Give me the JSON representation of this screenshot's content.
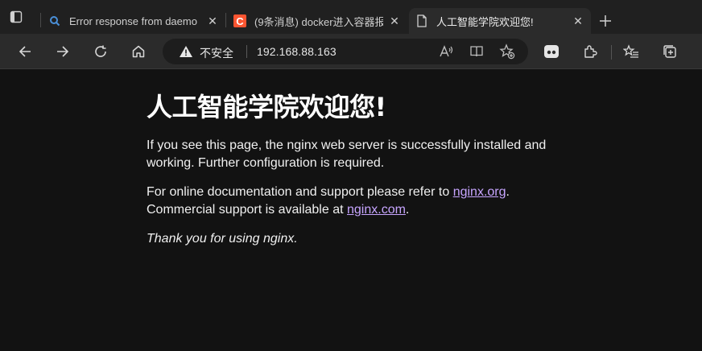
{
  "tabs": [
    {
      "title": "Error response from daemo",
      "favicon": "search-icon",
      "close": "✕"
    },
    {
      "title": "(9条消息) docker进入容器报",
      "favicon": "csdn-c-icon",
      "favicon_letter": "C",
      "close": "✕"
    },
    {
      "title": "人工智能学院欢迎您!",
      "favicon": "document-icon",
      "close": "✕",
      "active": true
    }
  ],
  "toolbar": {
    "security_label": "不安全",
    "url": "192.168.88.163"
  },
  "page": {
    "heading": "人工智能学院欢迎您!",
    "paragraph1": "If you see this page, the nginx web server is successfully installed and working. Further configuration is required.",
    "p2_prefix": "For online documentation and support please refer to ",
    "link1": "nginx.org",
    "p2_mid": ".",
    "p2_line2": "Commercial support is available at ",
    "link2": "nginx.com",
    "p2_end": ".",
    "thanks": "Thank you for using nginx."
  },
  "colors": {
    "background": "#121212",
    "link": "#c7a5ff",
    "csdn_accent": "#fc5531"
  }
}
